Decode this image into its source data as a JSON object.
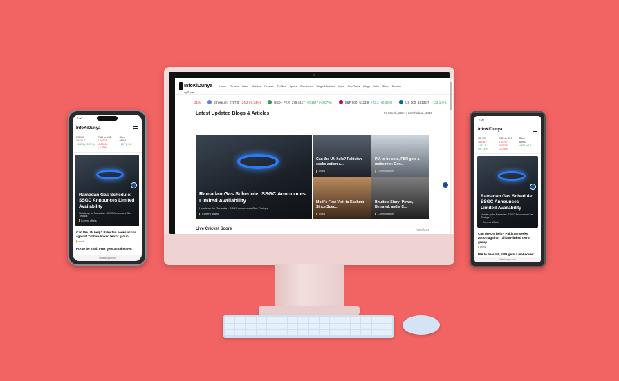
{
  "site": {
    "logo": "InfoKiDunya",
    "logo_sub": "سب کچھ",
    "nav": [
      "Home",
      "Results",
      "Islam",
      "Mobiles",
      "Finance",
      "Profiles",
      "Sports",
      "Directories",
      "Blogs & Articles",
      "Apps",
      "Free Tools",
      "Blogs",
      "Jobs",
      "Shop",
      "Election"
    ]
  },
  "ticker": [
    {
      "label": "21%",
      "change": "",
      "type": "neg",
      "icon_color": ""
    },
    {
      "label": "Ethereum",
      "value": "2797.0",
      "change": "-24.2 (-0.34%)",
      "type": "neg",
      "icon_color": "#627eea"
    },
    {
      "label": "USD - PKR",
      "value": "279.4417",
      "change": "+0.1827 (+0.07%)",
      "type": "pos",
      "icon_color": "#2a9d5a"
    },
    {
      "label": "S&P 500",
      "value": "5123.9",
      "change": "+23.3 (+0.46%)",
      "type": "pos",
      "icon_color": "#c0143c"
    },
    {
      "label": "US 100",
      "value": "18136.7",
      "change": "+132.1 (+0.",
      "type": "pos",
      "icon_color": "#0a6b8a"
    }
  ],
  "section": {
    "title": "Latest Updated Blogs & Articles",
    "date": "07 March, 2024 | 26 Sha'bān, 1445"
  },
  "cards": [
    {
      "title": "Ramadan Gas Schedule: SSGC Announces Limited Availability",
      "sub": "Heads-up for Ramadan: SSGC Announces Gas Timings",
      "cat": "Current affairs"
    },
    {
      "title": "Can the UN help? Pakistan seeks action a...",
      "cat": "world"
    },
    {
      "title": "PIA to be sold, FBR gets a makeover: Gov...",
      "cat": "Current affairs"
    },
    {
      "title": "Modi's First Visit to Kashmir Since Spec...",
      "cat": "world"
    },
    {
      "title": "Bhutto's Story: Power, Betrayal, and a C...",
      "cat": "Current affairs"
    }
  ],
  "live": {
    "title": "Live Cricket Score",
    "more": "View More"
  },
  "phone_left": {
    "time": "7:00",
    "logo": "InfoKiDunya",
    "ticker": [
      {
        "name": "US 100",
        "value": "18136.7",
        "change": "+132.1 (+0.73%)",
        "type": "pos"
      },
      {
        "name": "EUR to USD",
        "value": "1.09707",
        "change": "-0.00269 (-0.25%)",
        "type": "neg"
      },
      {
        "name": "Bitco",
        "value": "66941",
        "change": "+807 (+1.2",
        "type": "pos"
      }
    ],
    "hero_title": "Ramadan Gas Schedule: SSGC Announces Limited Availability",
    "hero_sub": "Heads-up for Ramadan: SSGC Announces Gas Timings",
    "hero_cat": "Current affairs",
    "articles": [
      {
        "title": "Can the UN help? Pakistan seeks action against Taliban-linked terror group",
        "cat": "world"
      },
      {
        "title": "PIA to be sold, FBR gets a makeover:",
        "cat": ""
      }
    ],
    "footer": "infokidunya.com"
  },
  "phone_right": {
    "time": "7:00",
    "logo": "InfoKiDunya",
    "ticker": [
      {
        "name": "US 100",
        "value": "18136.7",
        "change": "+132.1 (+0.73%)",
        "type": "pos"
      },
      {
        "name": "EUR to USD",
        "value": "1.09707",
        "change": "-0.00269 (-0.25%)",
        "type": "neg"
      },
      {
        "name": "Bitco",
        "value": "66941",
        "change": "+807 (+1.2",
        "type": "pos"
      }
    ],
    "hero_title": "Ramadan Gas Schedule: SSGC Announces Limited Availability",
    "hero_sub": "Heads-up for Ramadan: SSGC Announces Gas Timings",
    "hero_cat": "Current affairs",
    "articles": [
      {
        "title": "Can the UN help? Pakistan seeks action against Taliban-linked terror group",
        "cat": "world"
      },
      {
        "title": "PIA to be sold, FBR gets a makeover:",
        "cat": ""
      }
    ],
    "footer": "infokidunya.com"
  },
  "colors": {
    "background": "#f26363",
    "accent": "#f0a030",
    "access": "#1c4a8f"
  }
}
